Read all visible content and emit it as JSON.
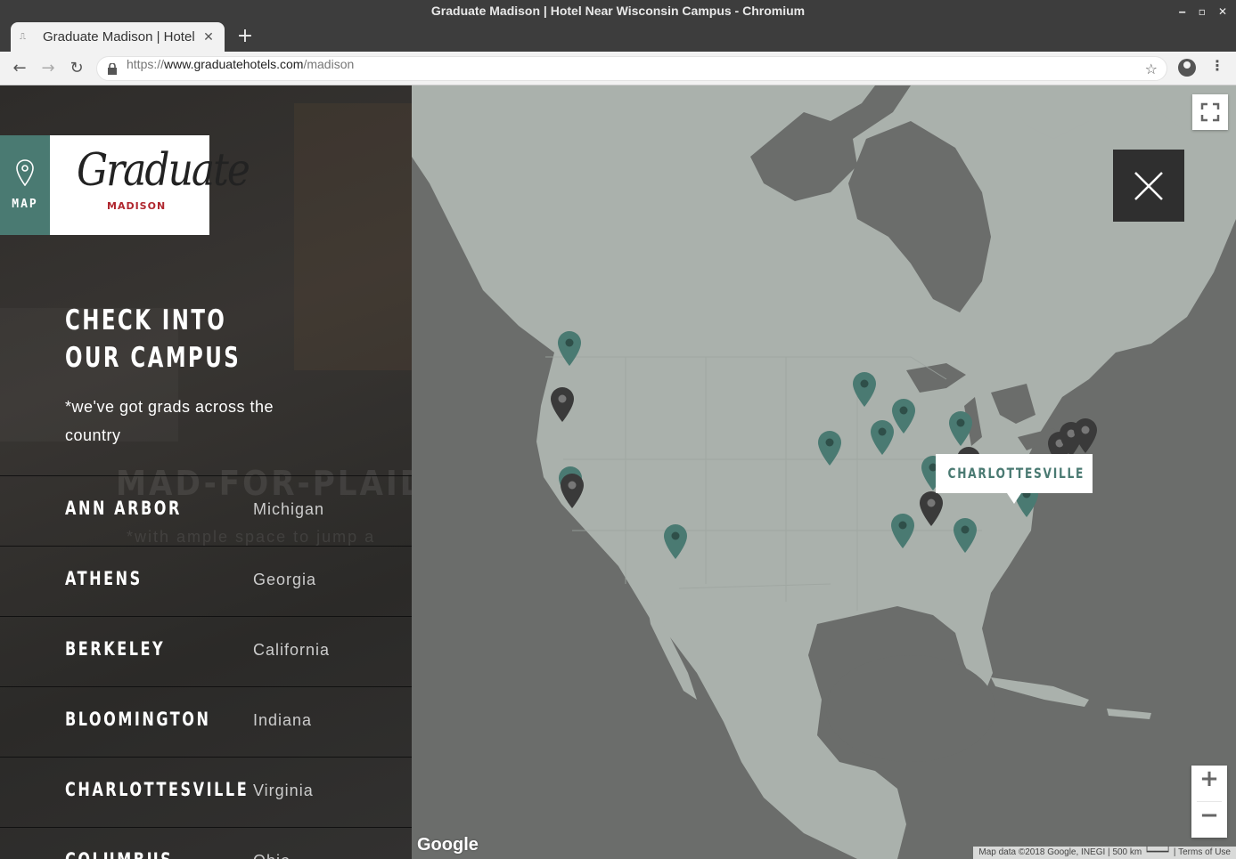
{
  "window": {
    "title": "Graduate Madison | Hotel Near Wisconsin Campus - Chromium"
  },
  "tab": {
    "title": "Graduate Madison | Hotel"
  },
  "address": {
    "scheme": "https://",
    "host": "www.graduatehotels.com",
    "path": "/madison"
  },
  "sidebar": {
    "map_label": "MAP",
    "logo_text": "Graduate",
    "logo_city": "MADISON",
    "heading": "CHECK INTO OUR CAMPUS",
    "subheading": "*we've got grads across the country",
    "ghost_heading": "MAD-FOR-PLAID D",
    "ghost_sub": "*with ample space to jump a",
    "campuses": [
      {
        "name": "ANN ARBOR",
        "state": "Michigan"
      },
      {
        "name": "ATHENS",
        "state": "Georgia"
      },
      {
        "name": "BERKELEY",
        "state": "California"
      },
      {
        "name": "BLOOMINGTON",
        "state": "Indiana"
      },
      {
        "name": "CHARLOTTESVILLE",
        "state": "Virginia"
      },
      {
        "name": "COLUMBUS",
        "state": "Ohio"
      }
    ]
  },
  "map": {
    "tooltip": "CHARLOTTESVILLE",
    "zoom_in": "+",
    "zoom_out": "−",
    "google_logo": "Google",
    "attribution": "Map data ©2018 Google, INEGI",
    "scale": "500 km",
    "terms": "Terms of Use",
    "colors": {
      "land": "#aab1ac",
      "water": "#6b6d6b",
      "pin_green": "#4a7a72",
      "pin_dark": "#3a3a3a"
    }
  }
}
